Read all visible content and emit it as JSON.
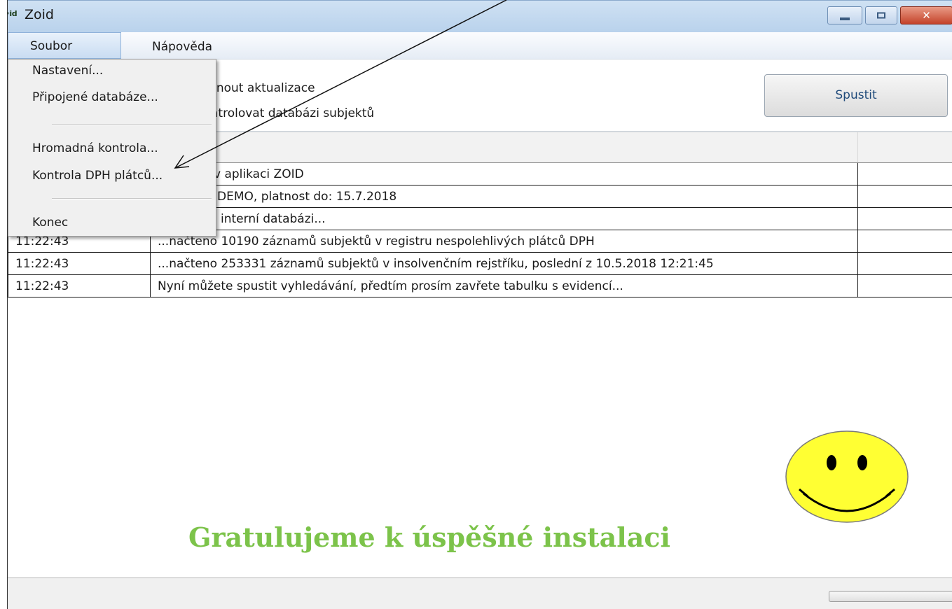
{
  "window": {
    "logo_text": "z•id",
    "title": "Zoid"
  },
  "menubar": {
    "file": "Soubor",
    "help": "Nápověda"
  },
  "file_menu": {
    "items": [
      "Nastavení...",
      "Připojené databáze...",
      "Hromadná kontrola...",
      "Kontrola DPH plátců...",
      "Konec"
    ]
  },
  "options": {
    "update_label": "Stáhnout aktualizace",
    "update_label_visible": "táhnout aktualizace",
    "check_label_visible": "kontrolovat databázi subjektů",
    "run_button": "Spustit"
  },
  "log": {
    "rows": [
      {
        "time": "",
        "message": "v aplikaci ZOID"
      },
      {
        "time": "",
        "message": "DEMO, platnost do: 15.7.2018"
      },
      {
        "time": "",
        "message": "interní databázi..."
      },
      {
        "time": "11:22:43",
        "message": "...načteno 10190 záznamů subjektů v registru nespolehlivých plátců DPH"
      },
      {
        "time": "11:22:43",
        "message": "...načteno 253331 záznamů subjektů v insolvenčním rejstříku, poslední z 10.5.2018 12:21:45"
      },
      {
        "time": "11:22:43",
        "message": "Nyní můžete spustit vyhledávání, předtím prosím zavřete tabulku s evidencí..."
      }
    ]
  },
  "overlay": {
    "congrats": "Gratulujeme k úspěšné instalaci",
    "smiley_icon": "smiley-face-icon",
    "annotation_arrow_icon": "pointer-arrow-icon"
  },
  "colors": {
    "congrats_green": "#7cc34a",
    "smiley_yellow": "#ffff33"
  }
}
